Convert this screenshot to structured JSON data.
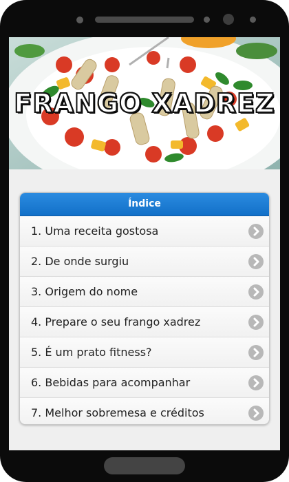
{
  "hero": {
    "title": "FRANGO XADREZ"
  },
  "index": {
    "header": "Índice",
    "items": [
      {
        "label": "1. Uma receita gostosa"
      },
      {
        "label": "2. De onde surgiu"
      },
      {
        "label": "3. Origem do nome"
      },
      {
        "label": "4. Prepare o seu frango xadrez"
      },
      {
        "label": "5. É um prato fitness?"
      },
      {
        "label": "6. Bebidas para acompanhar"
      },
      {
        "label": "7. Melhor sobremesa e créditos"
      }
    ]
  },
  "colors": {
    "header_blue": "#1a7ad4",
    "chevron_gray": "#b8b8b8"
  },
  "icons": {
    "item_icon": "chevron-right-icon"
  }
}
